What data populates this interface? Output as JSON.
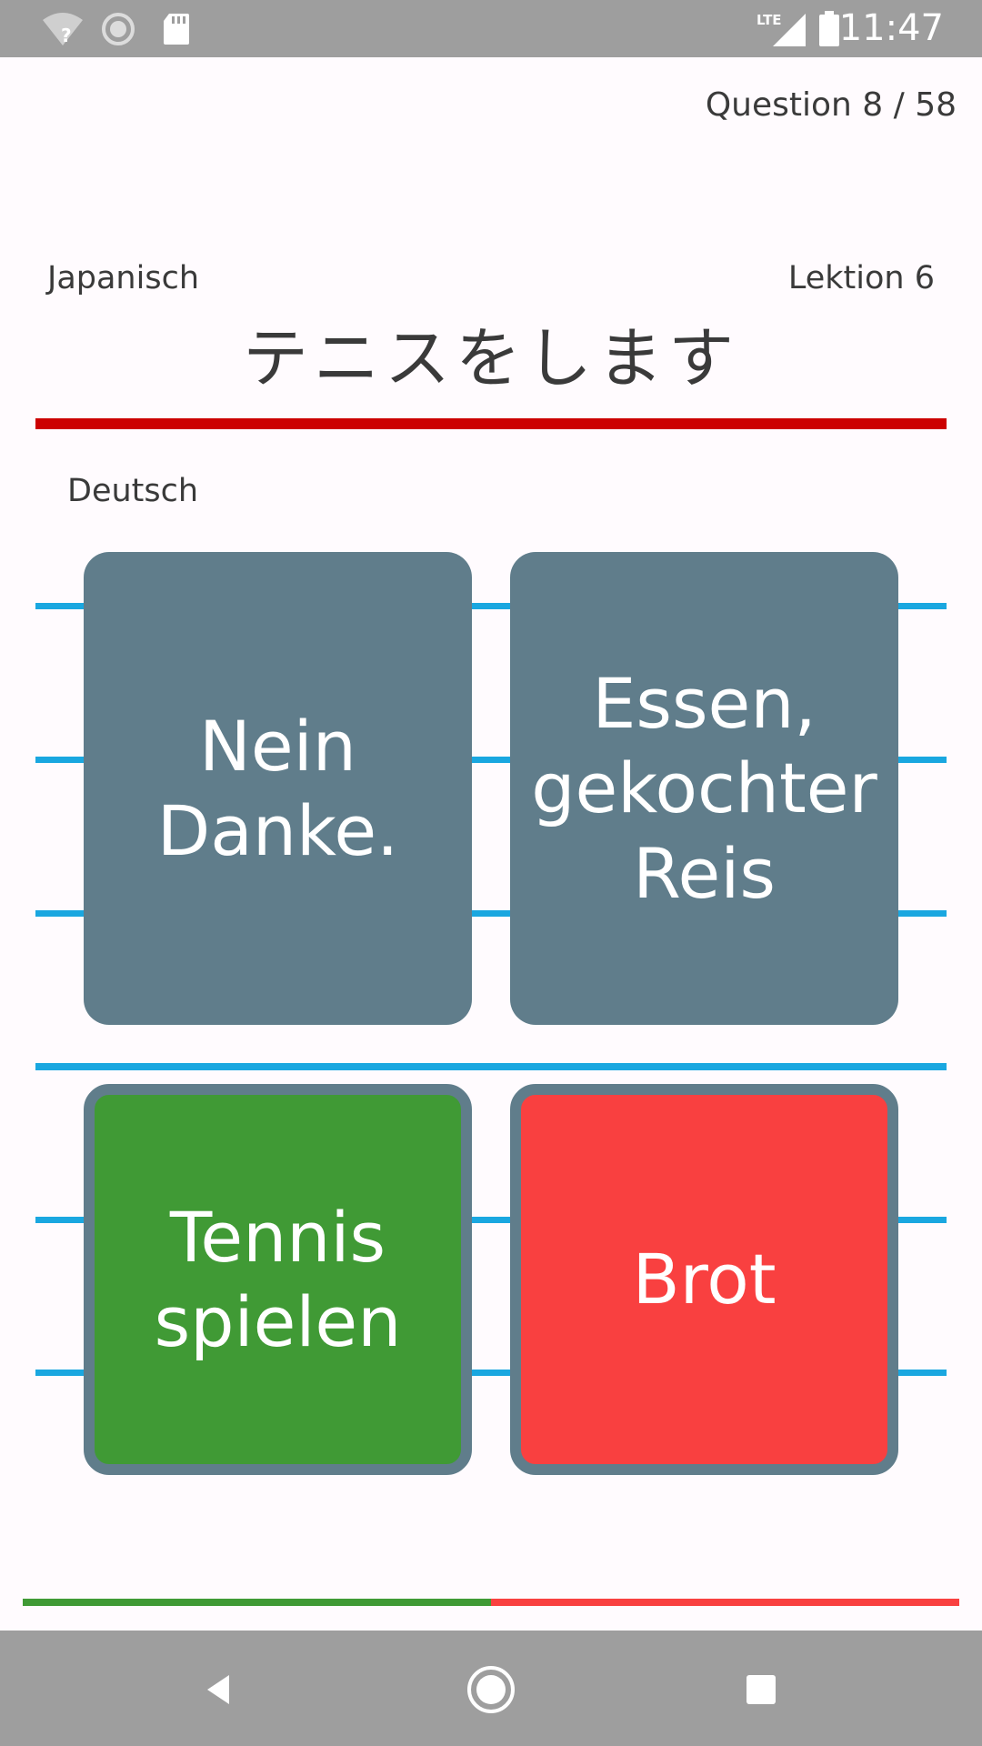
{
  "status_bar": {
    "time": "11:47",
    "network_label": "LTE",
    "icons": [
      "wifi-unknown-icon",
      "loading-icon",
      "sd-card-icon",
      "lte-signal-icon",
      "battery-icon"
    ]
  },
  "quiz": {
    "question_counter": "Question 8 / 58",
    "source_language": "Japanisch",
    "lesson": "Lektion 6",
    "prompt": "テニスをします",
    "target_language": "Deutsch"
  },
  "answers": [
    {
      "lines": [
        "Nein",
        "Danke."
      ],
      "state": "neutral"
    },
    {
      "lines": [
        "Essen,",
        "gekochter",
        "Reis"
      ],
      "state": "neutral"
    },
    {
      "lines": [
        "Tennis",
        "spielen"
      ],
      "state": "correct"
    },
    {
      "lines": [
        "Brot"
      ],
      "state": "wrong"
    }
  ],
  "progress": {
    "correct_fraction": 0.5,
    "wrong_fraction": 0.5
  },
  "colors": {
    "status_bar": "#9e9e9e",
    "card_neutral": "#607d8b",
    "card_correct": "#409a35",
    "card_wrong": "#f94040",
    "divider_red": "#cc0000",
    "guide_blue": "#1aa7e0"
  },
  "nav_bar": {
    "icons": [
      "back-icon",
      "home-icon",
      "recents-icon"
    ]
  }
}
